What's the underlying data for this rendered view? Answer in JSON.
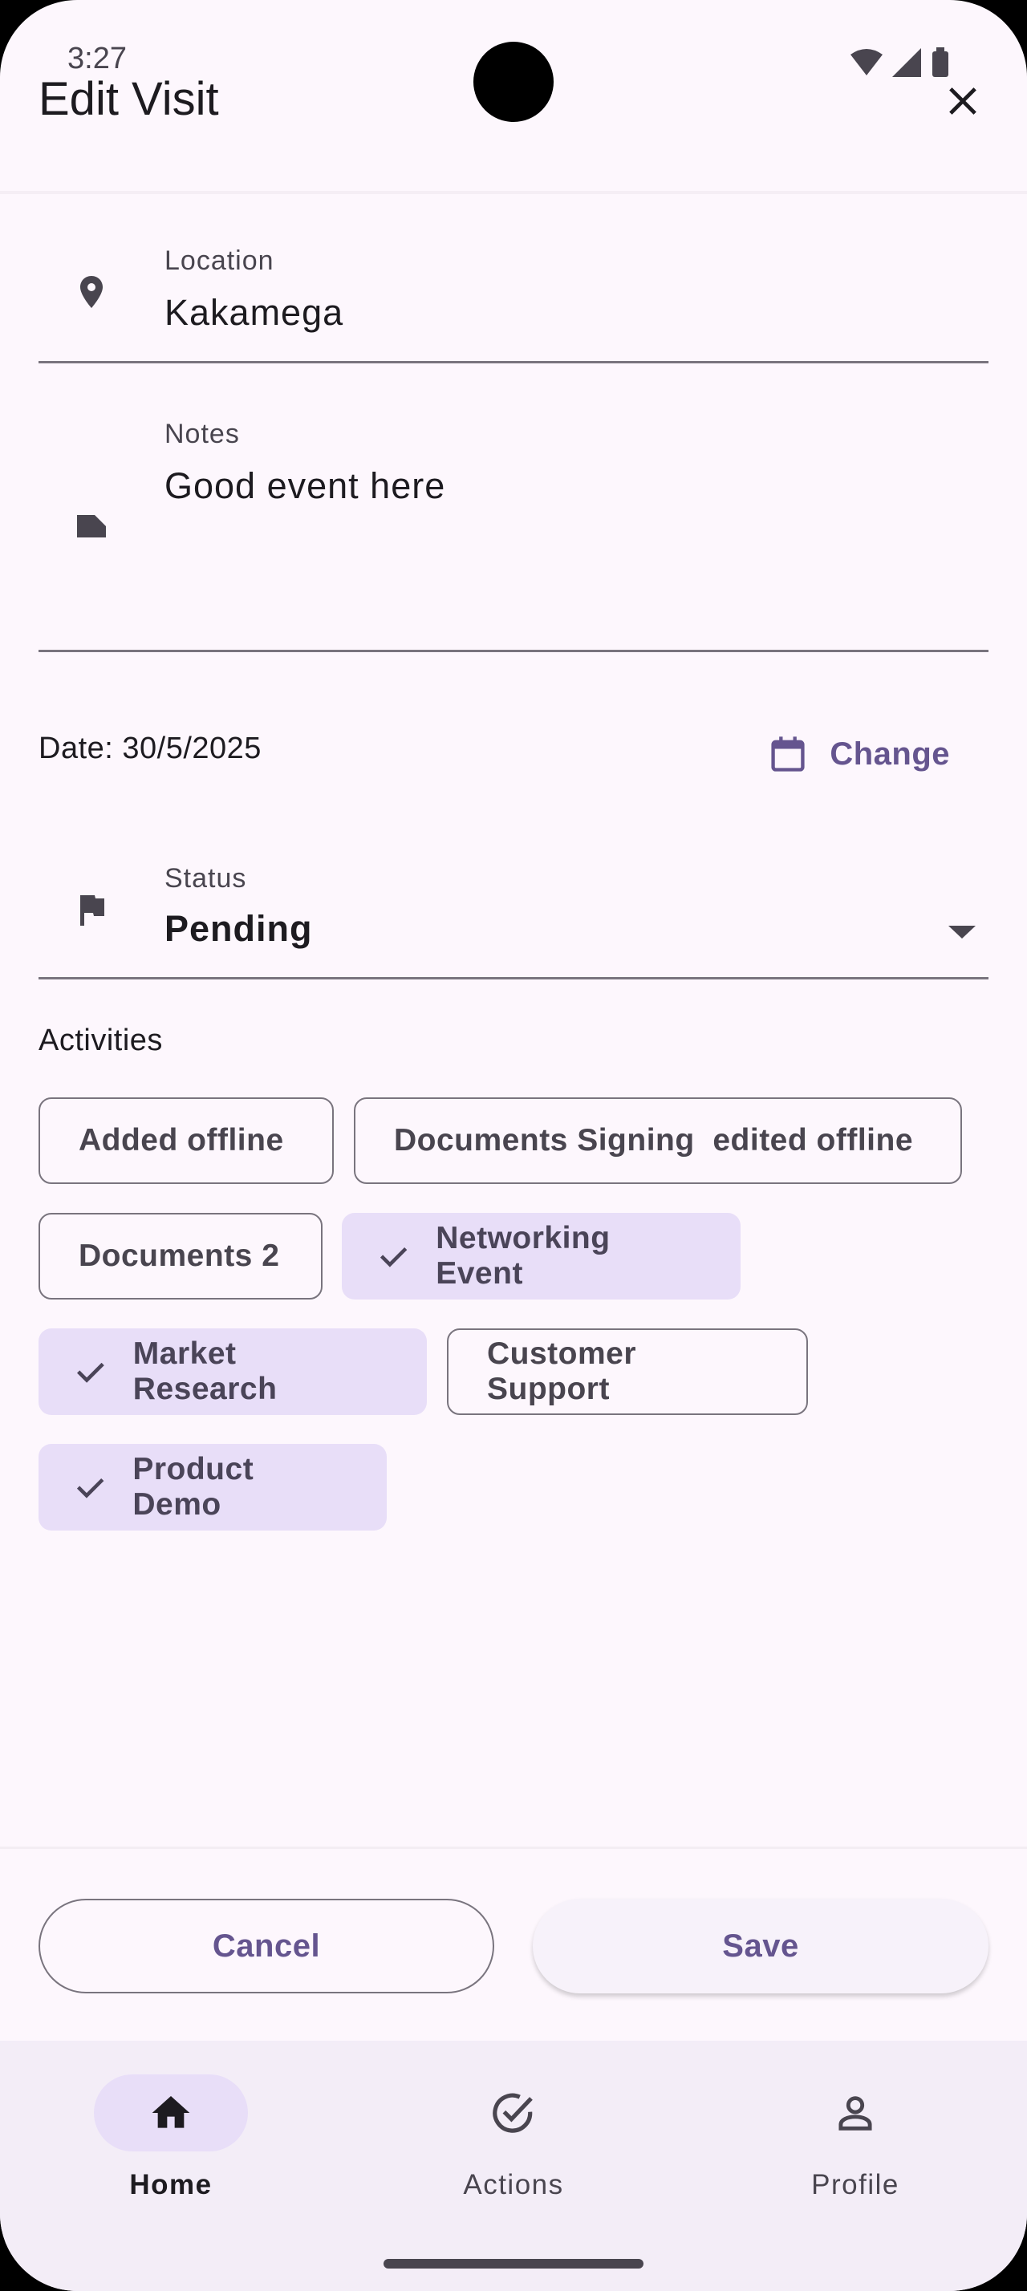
{
  "status_bar": {
    "time": "3:27"
  },
  "app_bar": {
    "title": "Edit Visit",
    "close_icon": "close-icon"
  },
  "form": {
    "location": {
      "label": "Location",
      "value": "Kakamega",
      "icon": "location-pin-icon"
    },
    "notes": {
      "label": "Notes",
      "value": "Good event here",
      "icon": "note-icon"
    },
    "date": {
      "text": "Date: 30/5/2025",
      "change_label": "Change",
      "icon": "calendar-icon"
    },
    "status": {
      "label": "Status",
      "value": "Pending",
      "icon": "flag-icon"
    }
  },
  "activities": {
    "title": "Activities",
    "chips": [
      {
        "label": "Added offline",
        "selected": false
      },
      {
        "label": "Documents Signing  edited offline",
        "selected": false
      },
      {
        "label": "Documents 2",
        "selected": false
      },
      {
        "label": "Networking Event",
        "selected": true
      },
      {
        "label": "Market Research",
        "selected": true
      },
      {
        "label": "Customer Support",
        "selected": false
      },
      {
        "label": "Product Demo",
        "selected": true
      }
    ]
  },
  "actions": {
    "cancel": "Cancel",
    "save": "Save"
  },
  "nav": {
    "items": [
      {
        "label": "Home",
        "icon": "home-icon",
        "active": true
      },
      {
        "label": "Actions",
        "icon": "check-circle-icon",
        "active": false
      },
      {
        "label": "Profile",
        "icon": "person-icon",
        "active": false
      }
    ]
  },
  "colors": {
    "accent": "#65558f",
    "chip_selected": "#e8def8",
    "background": "#fdf7fd"
  }
}
